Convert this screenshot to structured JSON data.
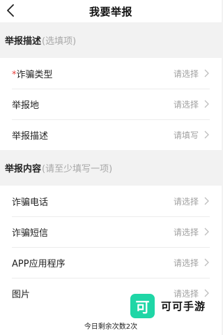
{
  "nav": {
    "title": "我要举报",
    "back_icon": "chevron-left-icon"
  },
  "section1": {
    "title": "举报描述",
    "hint": "(选填项)",
    "rows": [
      {
        "required": "*",
        "label": "诈骗类型",
        "value": "请选择"
      },
      {
        "label": "举报地",
        "value": "请选择"
      },
      {
        "label": "举报描述",
        "value": "请填写"
      }
    ]
  },
  "section2": {
    "title": "举报内容",
    "hint": "(请至少填写一项)",
    "rows": [
      {
        "label": "诈骗电话",
        "value": "请选择"
      },
      {
        "label": "诈骗短信",
        "value": "请选择"
      },
      {
        "label": "APP应用程序",
        "value": "请选择"
      },
      {
        "label": "图片",
        "value": "请选择"
      }
    ]
  },
  "footer": {
    "remaining": "今日剩余次数2次"
  },
  "watermark": {
    "logo_char": "可",
    "name": "可可手游",
    "color": "#1fd6a6"
  }
}
